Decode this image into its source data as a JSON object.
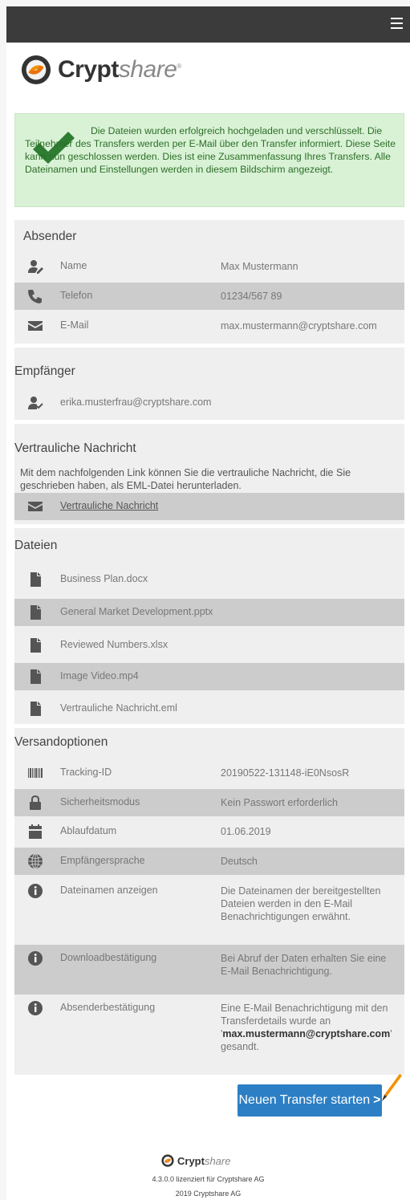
{
  "brand": {
    "name_bold": "Crypt",
    "name_thin": "share",
    "reg": "®"
  },
  "success_message": "Die Dateien wurden erfolgreich hochgeladen und verschlüsselt. Die Teilnehmer des Transfers werden per E-Mail über den Transfer informiert. Diese Seite kann nun geschlossen werden. Dies ist eine Zusammenfassung Ihres Transfers. Alle Dateinamen und Einstellungen werden in diesem Bildschirm angezeigt.",
  "sender": {
    "title": "Absender",
    "rows": [
      {
        "icon": "user-edit-icon",
        "label": "Name",
        "value": "Max Mustermann"
      },
      {
        "icon": "phone-icon",
        "label": "Telefon",
        "value": "01234/567 89"
      },
      {
        "icon": "envelope-icon",
        "label": "E-Mail",
        "value": "max.mustermann@cryptshare.com"
      }
    ]
  },
  "recipient": {
    "title": "Empfänger",
    "email": "erika.musterfrau@cryptshare.com"
  },
  "confidential": {
    "title": "Vertrauliche Nachricht",
    "description": "Mit dem nachfolgenden Link können Sie die vertrauliche Nachricht, die Sie geschrieben haben, als EML-Datei herunterladen.",
    "link": "Vertrauliche Nachricht"
  },
  "files": {
    "title": "Dateien",
    "items": [
      "Business Plan.docx",
      "General Market Development.pptx",
      "Reviewed Numbers.xlsx",
      "Image Video.mp4",
      "Vertrauliche Nachricht.eml"
    ]
  },
  "options": {
    "title": "Versandoptionen",
    "rows": [
      {
        "icon": "barcode-icon",
        "label": "Tracking-ID",
        "value": "20190522-131148-iE0NsosR"
      },
      {
        "icon": "lock-icon",
        "label": "Sicherheitsmodus",
        "value": "Kein Passwort erforderlich"
      },
      {
        "icon": "calendar-icon",
        "label": "Ablaufdatum",
        "value": "01.06.2019"
      },
      {
        "icon": "globe-icon",
        "label": "Empfängersprache",
        "value": "Deutsch"
      },
      {
        "icon": "info-icon",
        "label": "Dateinamen anzeigen",
        "value": "Die Dateinamen der bereitgestellten Dateien werden in den E-Mail Benachrichtigungen erwähnt."
      },
      {
        "icon": "info-icon",
        "label": "Downloadbestätigung",
        "value": "Bei Abruf der Daten erhalten Sie eine E-Mail Benachrichtigung."
      },
      {
        "icon": "info-icon",
        "label": "Absenderbestätigung",
        "value_before": "Eine E-Mail Benachrichtigung mit den Transferdetails wurde an",
        "value_bold": "max.mustermann@cryptshare.com",
        "value_after": "gesandt."
      }
    ]
  },
  "button": {
    "label": "Neuen Transfer starten",
    "arrow": ">"
  },
  "footer": {
    "license": "4.3.0.0 lizenziert für Cryptshare AG",
    "copyright": "2019 Cryptshare AG"
  },
  "colors": {
    "topbar": "#3b3b3b",
    "success_bg": "#d9f2d6",
    "success_text": "#2c6e27",
    "check": "#2e7d32",
    "button": "#2c7fc5",
    "row_dark": "#cccccc",
    "panel": "#efefef"
  }
}
